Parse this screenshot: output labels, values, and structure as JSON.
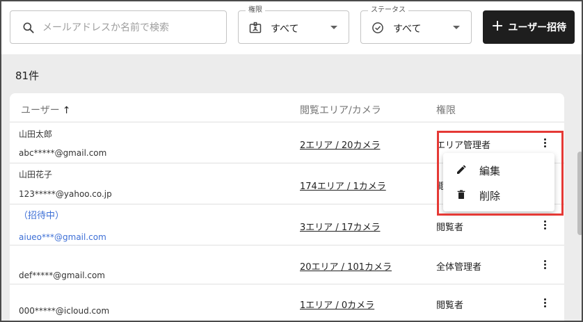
{
  "search": {
    "placeholder": "メールアドレスか名前で検索",
    "icon": "search-icon"
  },
  "filters": {
    "role": {
      "legend": "権限",
      "value": "すべて",
      "icon": "badge-icon"
    },
    "status": {
      "legend": "ステータス",
      "value": "すべて",
      "icon": "check-circle-icon"
    }
  },
  "invite_button": {
    "label": "ユーザー招待",
    "icon": "plus-icon"
  },
  "count": "81件",
  "table": {
    "headers": {
      "user": "ユーザー",
      "area": "閲覧エリア/カメラ",
      "role": "権限"
    },
    "sort_arrow": "↑",
    "rows": [
      {
        "name": "山田太郎",
        "email": "abc*****@gmail.com",
        "area": "2エリア / 20カメラ",
        "role": "エリア管理者",
        "invited": false
      },
      {
        "name": "山田花子",
        "email": "123*****@yahoo.co.jp",
        "area": "174エリア / 1カメラ",
        "role": "閲",
        "invited": false
      },
      {
        "name": "（招待中）",
        "email": "aiueo***@gmail.com",
        "area": "3エリア / 17カメラ",
        "role": "閲覧者",
        "invited": true
      },
      {
        "name": "",
        "email": "def*****@gmail.com",
        "area": "20エリア / 101カメラ",
        "role": "全体管理者",
        "invited": false
      },
      {
        "name": "",
        "email": "000*****@icloud.com",
        "area": "1エリア / 0カメラ",
        "role": "閲覧者",
        "invited": false
      }
    ]
  },
  "menu": {
    "items": [
      {
        "label": "編集",
        "icon": "pencil-icon"
      },
      {
        "label": "削除",
        "icon": "trash-icon"
      }
    ]
  },
  "colors": {
    "accent_dark": "#1e1e1e",
    "invited_text": "#3d6fd6",
    "highlight": "#e53935",
    "background": "#ececec"
  }
}
